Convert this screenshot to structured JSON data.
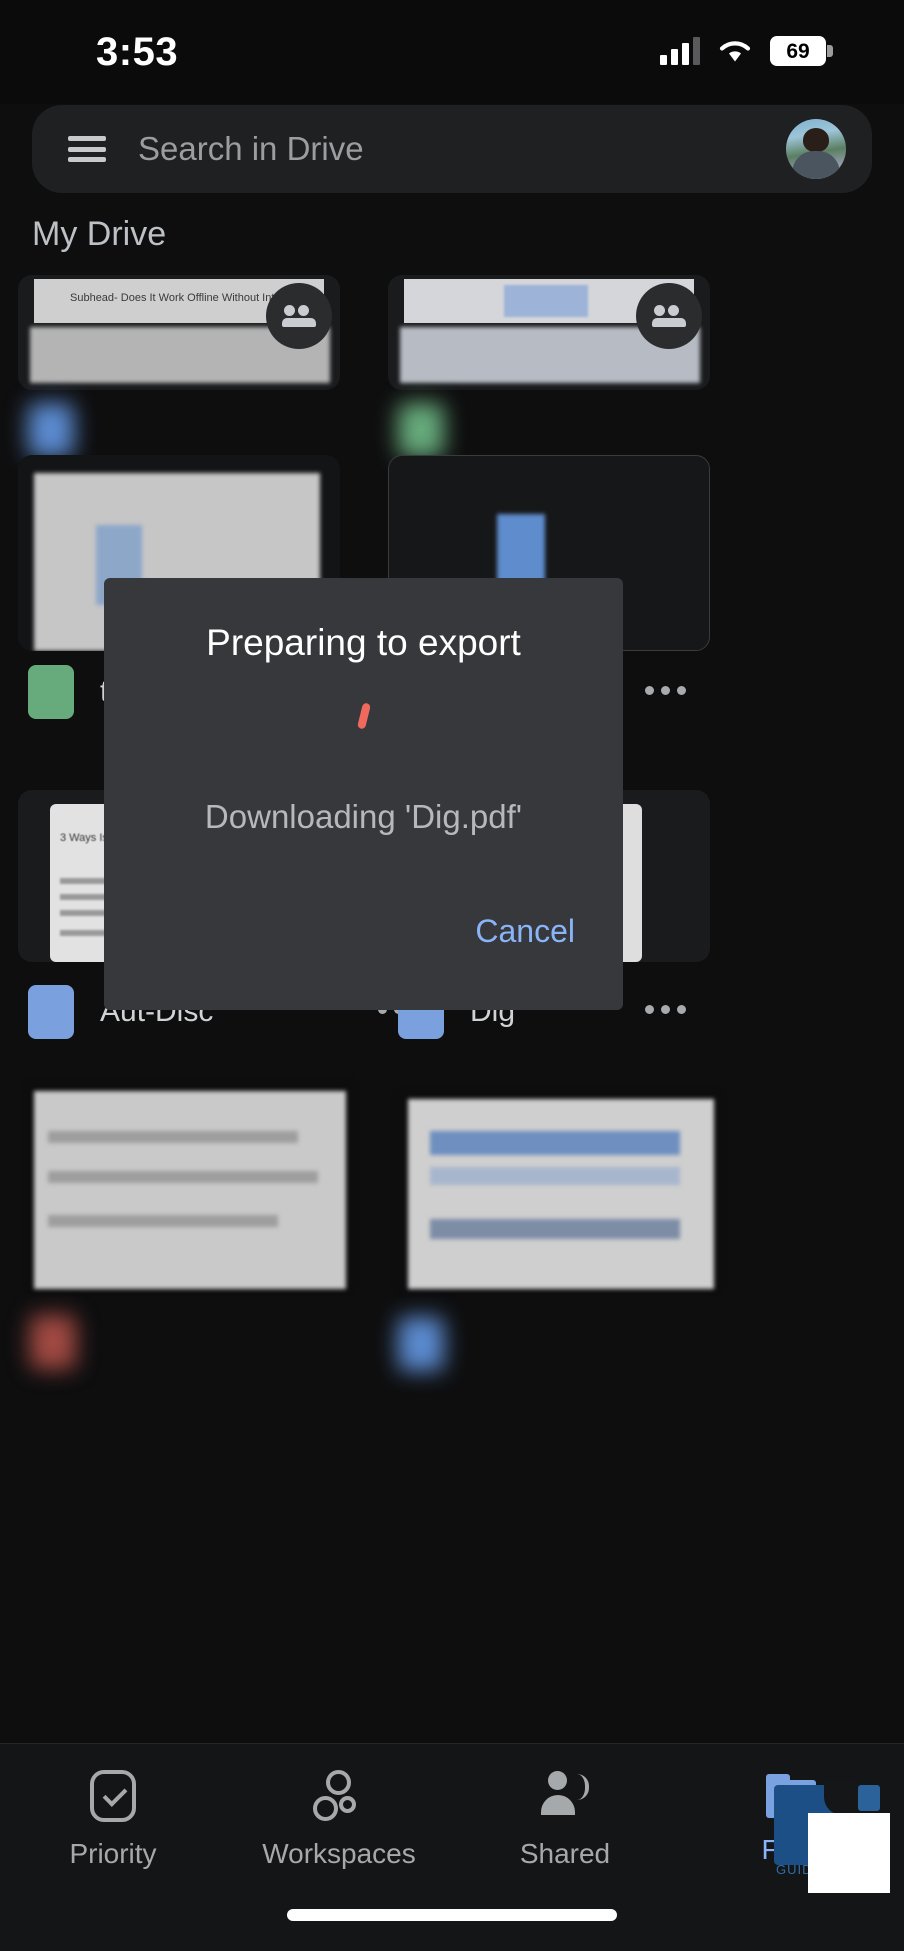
{
  "status_bar": {
    "time": "3:53",
    "signal_icon": "cellular-signal-icon",
    "wifi_icon": "wifi-icon",
    "battery_percent": "69"
  },
  "search": {
    "menu_icon": "hamburger-menu-icon",
    "placeholder": "Search in Drive",
    "value": "",
    "avatar_label": "account-avatar"
  },
  "section": {
    "title": "My Drive"
  },
  "files": [
    {
      "name": "",
      "type_icon": "docs-icon",
      "thumb_caption": "Subhead- Does It Work Offline Without Internet?",
      "shared": true
    },
    {
      "name": "",
      "type_icon": "sheets-icon",
      "thumb_caption": "",
      "shared": true
    },
    {
      "name": "t",
      "type_icon": "sheets-icon",
      "thumb_caption": "",
      "shared": false
    },
    {
      "name": "",
      "type_icon": "docs-icon",
      "thumb_caption": "",
      "shared": false
    },
    {
      "name": "Aut-Disc",
      "type_icon": "docs-icon",
      "thumb_caption": "3 Ways  Issues",
      "shared": false
    },
    {
      "name": "Dig",
      "type_icon": "docs-icon",
      "thumb_caption": "",
      "shared": false
    },
    {
      "name": "",
      "type_icon": "pdf-icon",
      "thumb_caption": "",
      "shared": false
    },
    {
      "name": "",
      "type_icon": "docs-icon",
      "thumb_caption": "",
      "shared": false
    }
  ],
  "dialog": {
    "title": "Preparing to export",
    "spinner_icon": "loading-spinner-icon",
    "spinner_color": "#ef6a5d",
    "message": "Downloading 'Dig.pdf'",
    "cancel_label": "Cancel",
    "cancel_color": "#8ab4f8",
    "background_color": "#37383c"
  },
  "bottom_nav": {
    "items": [
      {
        "label": "Priority",
        "icon": "priority-check-icon",
        "active": false
      },
      {
        "label": "Workspaces",
        "icon": "workspaces-circles-icon",
        "active": false
      },
      {
        "label": "Shared",
        "icon": "shared-people-icon",
        "active": false
      },
      {
        "label": "Files",
        "icon": "files-folder-icon",
        "active": true
      }
    ],
    "active_color": "#8ab4f8",
    "inactive_color": "#a6a9ac"
  },
  "watermark": {
    "text": "GUIDING",
    "color": "#1b4f85"
  }
}
